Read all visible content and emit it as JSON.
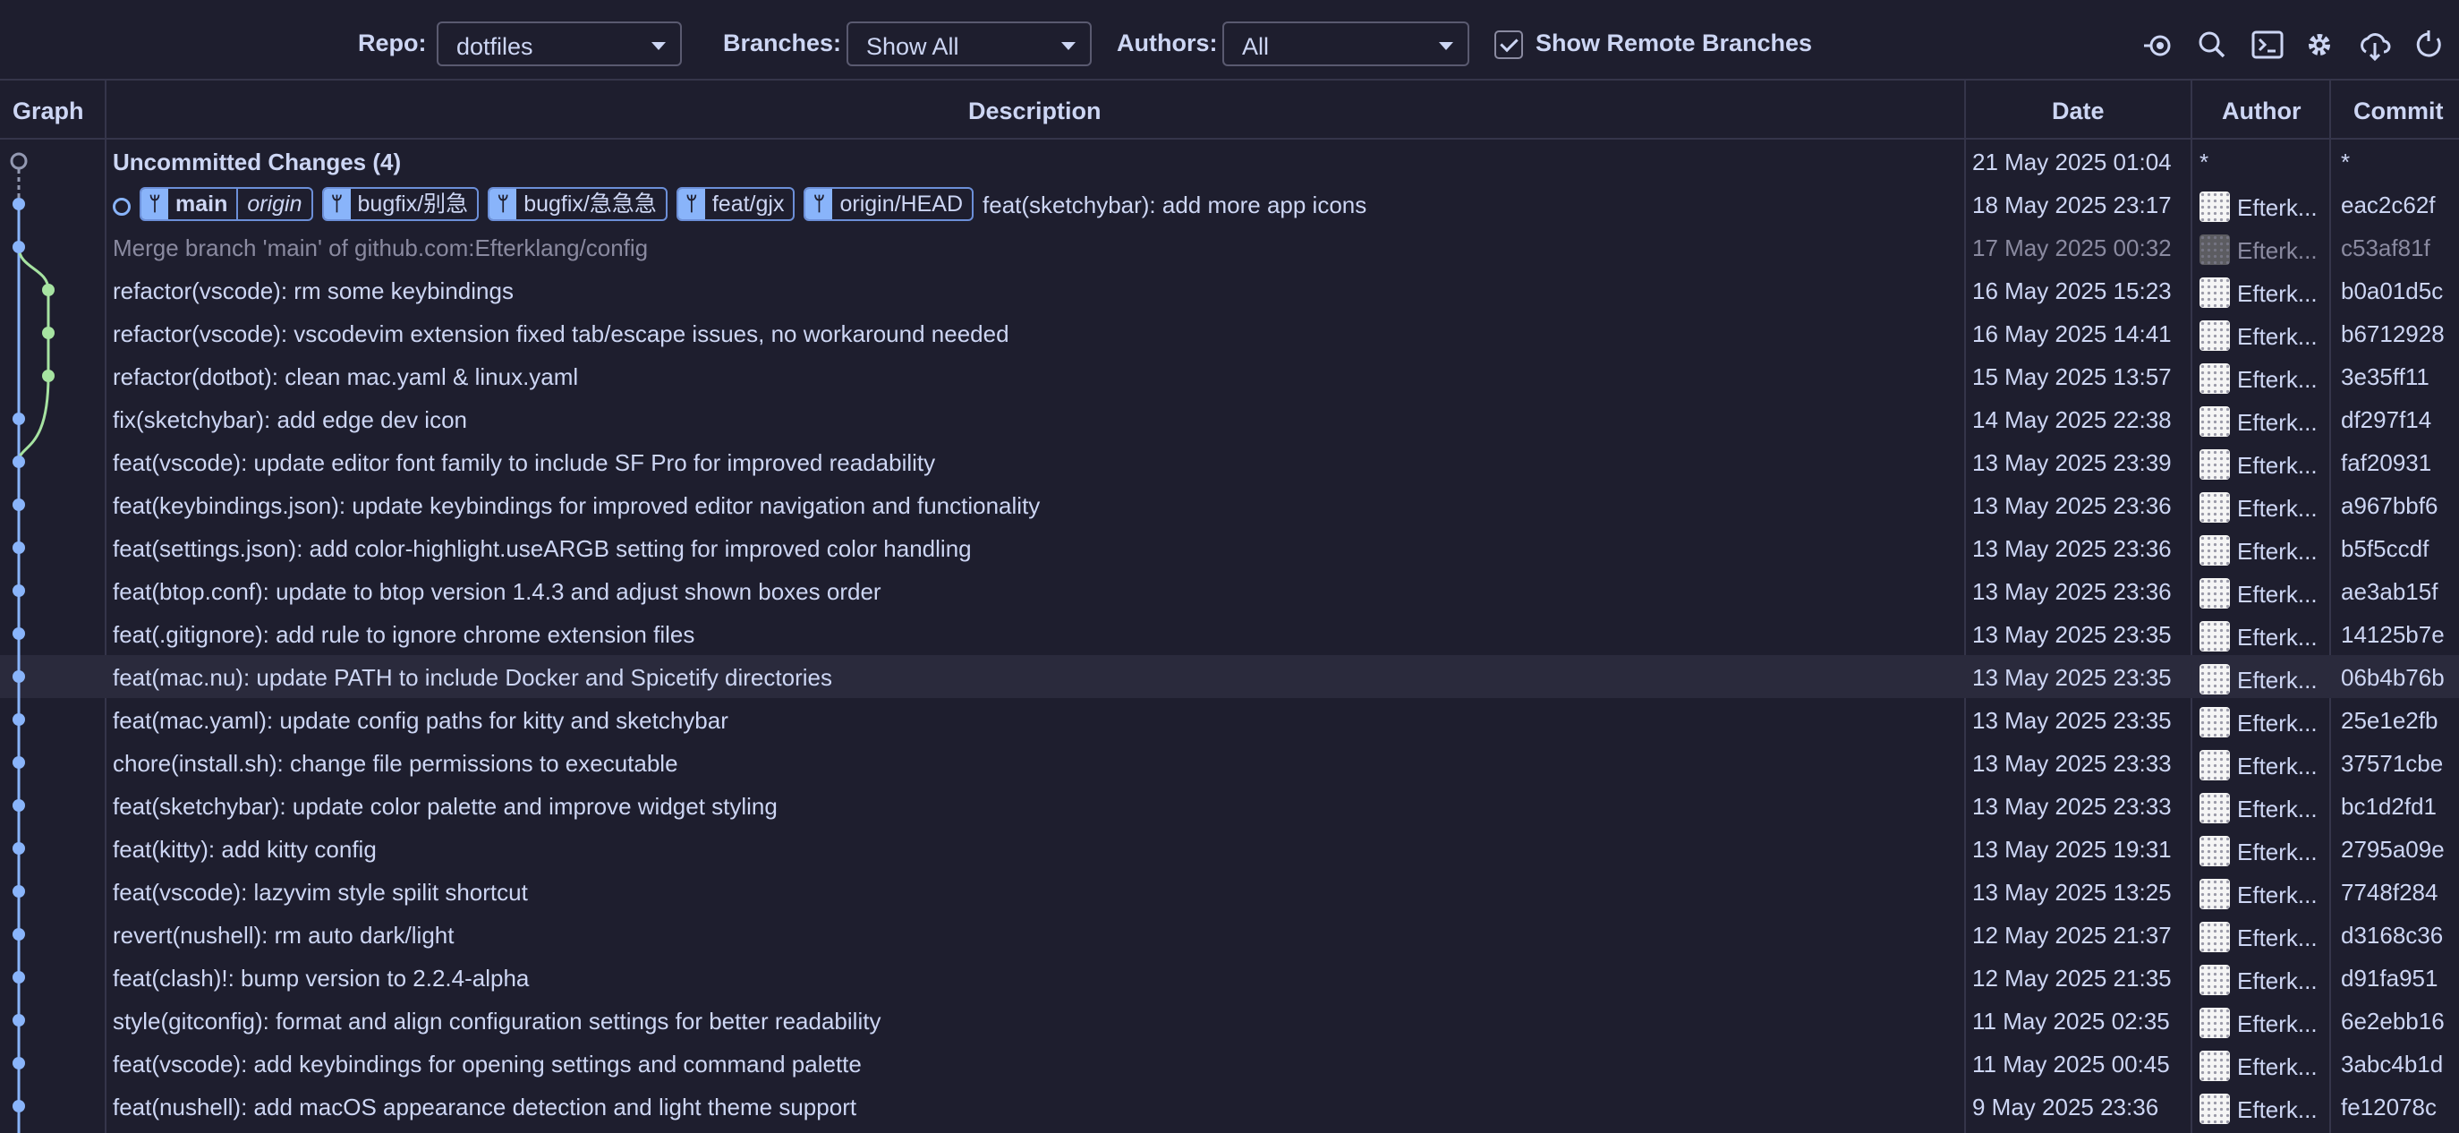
{
  "controls": {
    "repo_label": "Repo:",
    "repo_value": "dotfiles",
    "branches_label": "Branches:",
    "branches_value": "Show All",
    "authors_label": "Authors:",
    "authors_value": "All",
    "remote_label": "Show Remote Branches",
    "remote_checked": true,
    "icons": [
      "eye-target-icon",
      "search-icon",
      "terminal-icon",
      "gear-icon",
      "cloud-download-icon",
      "refresh-icon"
    ]
  },
  "columns": {
    "graph": "Graph",
    "description": "Description",
    "date": "Date",
    "author": "Author",
    "commit": "Commit"
  },
  "colors": {
    "main_branch": "#89b4fa",
    "side_branch": "#a6e3a1",
    "uncommitted": "#9399b2"
  },
  "refs": [
    {
      "name": "main",
      "remote": "origin",
      "head": true
    },
    {
      "name": "bugfix/别急"
    },
    {
      "name": "bugfix/急急急"
    },
    {
      "name": "feat/gjx"
    },
    {
      "name": "origin/HEAD"
    }
  ],
  "commits": [
    {
      "desc": "Uncommitted Changes (4)",
      "date": "21 May 2025 01:04",
      "author": "*",
      "hash": "*",
      "uncommitted": true,
      "lane": 0
    },
    {
      "desc": "feat(sketchybar): add more app icons",
      "date": "18 May 2025 23:17",
      "author": "Efterk...",
      "hash": "eac2c62f",
      "refs": true,
      "lane": 0
    },
    {
      "desc": "Merge branch 'main' of github.com:Efterklang/config",
      "date": "17 May 2025 00:32",
      "author": "Efterk...",
      "hash": "c53af81f",
      "dim": true,
      "lane": 0,
      "merge": true
    },
    {
      "desc": "refactor(vscode): rm some keybindings",
      "date": "16 May 2025 15:23",
      "author": "Efterk...",
      "hash": "b0a01d5c",
      "lane": 1
    },
    {
      "desc": "refactor(vscode): vscodevim extension fixed tab/escape issues, no workaround needed",
      "date": "16 May 2025 14:41",
      "author": "Efterk...",
      "hash": "b6712928",
      "lane": 1
    },
    {
      "desc": "refactor(dotbot): clean mac.yaml & linux.yaml",
      "date": "15 May 2025 13:57",
      "author": "Efterk...",
      "hash": "3e35ff11",
      "lane": 1
    },
    {
      "desc": "fix(sketchybar): add edge dev icon",
      "date": "14 May 2025 22:38",
      "author": "Efterk...",
      "hash": "df297f14",
      "lane": 0
    },
    {
      "desc": "feat(vscode): update editor font family to include SF Pro for improved readability",
      "date": "13 May 2025 23:39",
      "author": "Efterk...",
      "hash": "faf20931",
      "lane": 0,
      "fork": true
    },
    {
      "desc": "feat(keybindings.json): update keybindings for improved editor navigation and functionality",
      "date": "13 May 2025 23:36",
      "author": "Efterk...",
      "hash": "a967bbf6",
      "lane": 0
    },
    {
      "desc": "feat(settings.json): add color-highlight.useARGB setting for improved color handling",
      "date": "13 May 2025 23:36",
      "author": "Efterk...",
      "hash": "b5f5ccdf",
      "lane": 0
    },
    {
      "desc": "feat(btop.conf): update to btop version 1.4.3 and adjust shown boxes order",
      "date": "13 May 2025 23:36",
      "author": "Efterk...",
      "hash": "ae3ab15f",
      "lane": 0
    },
    {
      "desc": "feat(.gitignore): add rule to ignore chrome extension files",
      "date": "13 May 2025 23:35",
      "author": "Efterk...",
      "hash": "14125b7e",
      "lane": 0
    },
    {
      "desc": "feat(mac.nu): update PATH to include Docker and Spicetify directories",
      "date": "13 May 2025 23:35",
      "author": "Efterk...",
      "hash": "06b4b76b",
      "lane": 0,
      "highlight": true
    },
    {
      "desc": "feat(mac.yaml): update config paths for kitty and sketchybar",
      "date": "13 May 2025 23:35",
      "author": "Efterk...",
      "hash": "25e1e2fb",
      "lane": 0
    },
    {
      "desc": "chore(install.sh): change file permissions to executable",
      "date": "13 May 2025 23:33",
      "author": "Efterk...",
      "hash": "37571cbe",
      "lane": 0
    },
    {
      "desc": "feat(sketchybar): update color palette and improve widget styling",
      "date": "13 May 2025 23:33",
      "author": "Efterk...",
      "hash": "bc1d2fd1",
      "lane": 0
    },
    {
      "desc": "feat(kitty): add kitty config",
      "date": "13 May 2025 19:31",
      "author": "Efterk...",
      "hash": "2795a09e",
      "lane": 0
    },
    {
      "desc": "feat(vscode): lazyvim style spilit shortcut",
      "date": "13 May 2025 13:25",
      "author": "Efterk...",
      "hash": "7748f284",
      "lane": 0
    },
    {
      "desc": "revert(nushell): rm auto dark/light",
      "date": "12 May 2025 21:37",
      "author": "Efterk...",
      "hash": "d3168c36",
      "lane": 0
    },
    {
      "desc": "feat(clash)!: bump version to 2.2.4-alpha",
      "date": "12 May 2025 21:35",
      "author": "Efterk...",
      "hash": "d91fa951",
      "lane": 0
    },
    {
      "desc": "style(gitconfig): format and align configuration settings for better readability",
      "date": "11 May 2025 02:35",
      "author": "Efterk...",
      "hash": "6e2ebb16",
      "lane": 0
    },
    {
      "desc": "feat(vscode): add keybindings for opening settings and command palette",
      "date": "11 May 2025 00:45",
      "author": "Efterk...",
      "hash": "3abc4b1d",
      "lane": 0
    },
    {
      "desc": "feat(nushell): add macOS appearance detection and light theme support",
      "date": "9 May 2025 23:36",
      "author": "Efterk...",
      "hash": "fe12078c",
      "lane": 0
    }
  ]
}
